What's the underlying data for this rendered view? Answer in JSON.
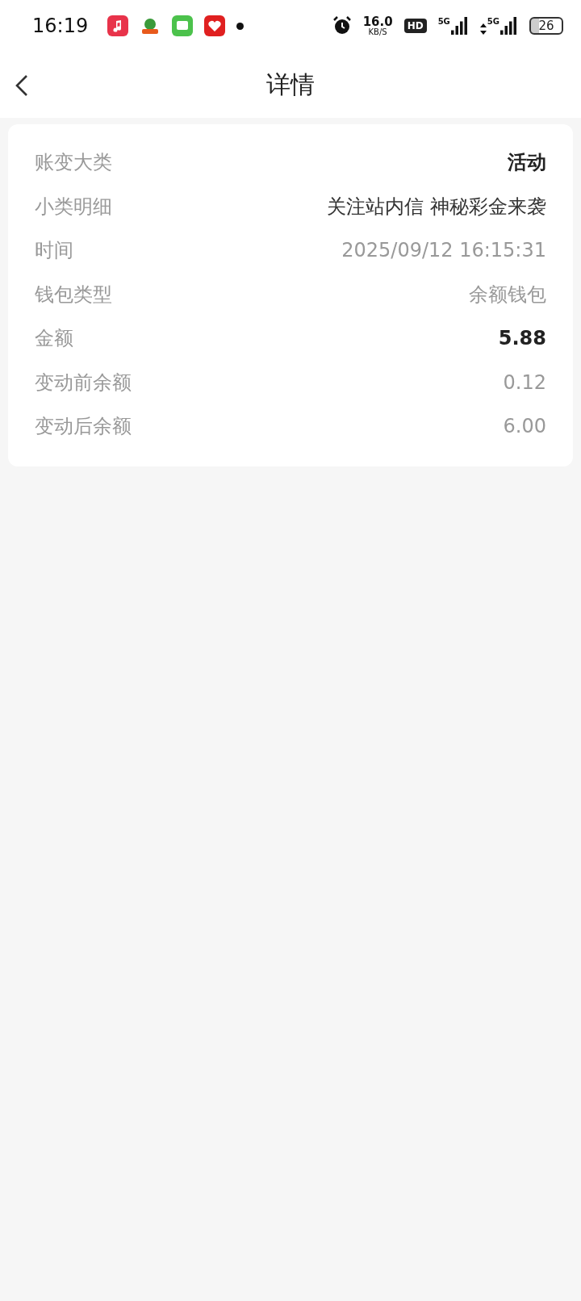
{
  "status_bar": {
    "time": "16:19",
    "net_speed": "16.0",
    "net_unit": "KB/S",
    "hd": "HD",
    "signals": [
      "5G",
      "5G"
    ],
    "battery": "26"
  },
  "header": {
    "title": "详情"
  },
  "details": [
    {
      "label": "账变大类",
      "value": "活动",
      "kind": "strong"
    },
    {
      "label": "小类明细",
      "value": "关注站内信 神秘彩金来袭",
      "kind": "dark"
    },
    {
      "label": "时间",
      "value": "2025/09/12 16:15:31",
      "kind": "muted"
    },
    {
      "label": "钱包类型",
      "value": "余额钱包",
      "kind": "muted"
    },
    {
      "label": "金额",
      "value": "5.88",
      "kind": "strong"
    },
    {
      "label": "变动前余额",
      "value": "0.12",
      "kind": "muted"
    },
    {
      "label": "变动后余额",
      "value": "6.00",
      "kind": "muted"
    }
  ]
}
